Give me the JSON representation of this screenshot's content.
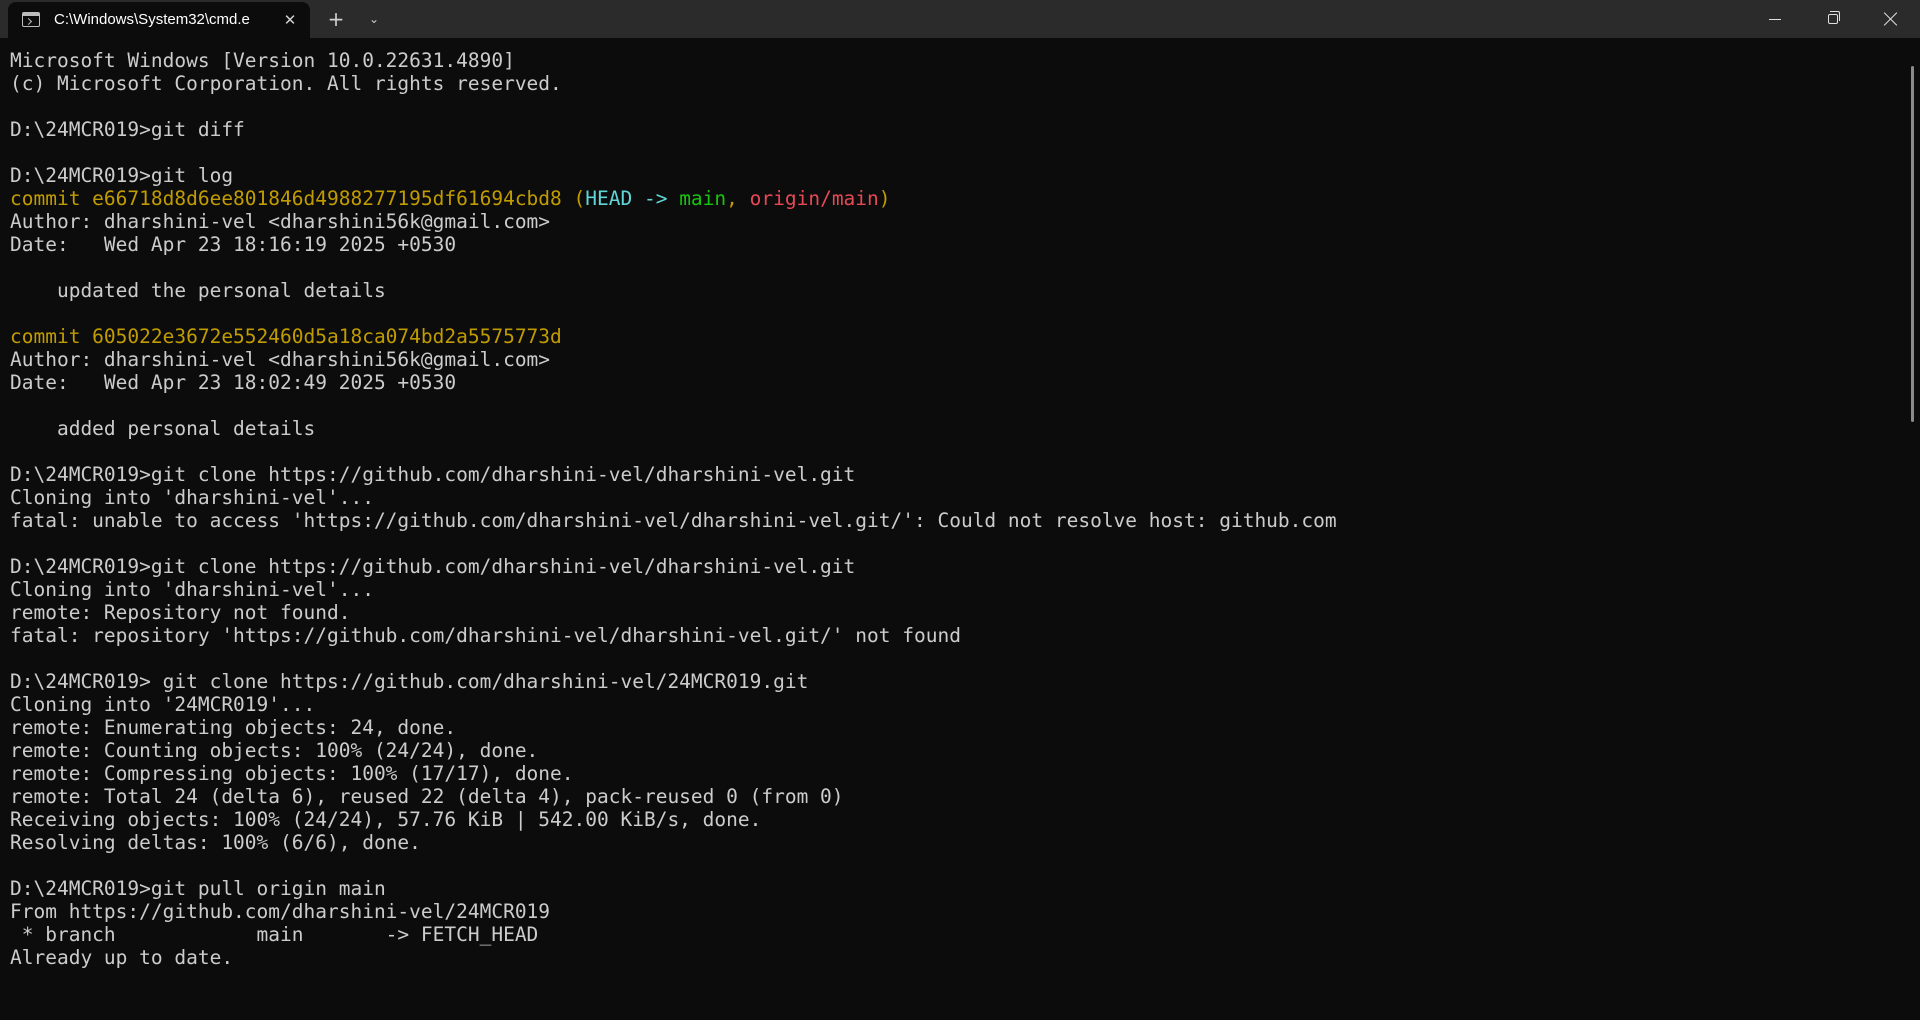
{
  "window": {
    "tab_title": "C:\\Windows\\System32\\cmd.e",
    "new_tab_label": "+",
    "dropdown_label": "⌄",
    "close_tab_label": "✕"
  },
  "terminal": {
    "lines": [
      [
        {
          "t": "Microsoft Windows [Version 10.0.22631.4890]"
        }
      ],
      [
        {
          "t": "(c) Microsoft Corporation. All rights reserved."
        }
      ],
      [],
      [
        {
          "t": "D:\\24MCR019>git diff"
        }
      ],
      [],
      [
        {
          "t": "D:\\24MCR019>git log"
        }
      ],
      [
        {
          "t": "commit e66718d8d6ee801846d4988277195df61694cbd8 (",
          "c": "yellow"
        },
        {
          "t": "HEAD -> ",
          "c": "cyan"
        },
        {
          "t": "main",
          "c": "green"
        },
        {
          "t": ", ",
          "c": "yellow"
        },
        {
          "t": "origin/main",
          "c": "red"
        },
        {
          "t": ")",
          "c": "yellow"
        }
      ],
      [
        {
          "t": "Author: dharshini-vel <dharshini56k@gmail.com>"
        }
      ],
      [
        {
          "t": "Date:   Wed Apr 23 18:16:19 2025 +0530"
        }
      ],
      [],
      [
        {
          "t": "    updated the personal details"
        }
      ],
      [],
      [
        {
          "t": "commit 605022e3672e552460d5a18ca074bd2a5575773d",
          "c": "yellow"
        }
      ],
      [
        {
          "t": "Author: dharshini-vel <dharshini56k@gmail.com>"
        }
      ],
      [
        {
          "t": "Date:   Wed Apr 23 18:02:49 2025 +0530"
        }
      ],
      [],
      [
        {
          "t": "    added personal details"
        }
      ],
      [],
      [
        {
          "t": "D:\\24MCR019>git clone https://github.com/dharshini-vel/dharshini-vel.git"
        }
      ],
      [
        {
          "t": "Cloning into 'dharshini-vel'..."
        }
      ],
      [
        {
          "t": "fatal: unable to access 'https://github.com/dharshini-vel/dharshini-vel.git/': Could not resolve host: github.com"
        }
      ],
      [],
      [
        {
          "t": "D:\\24MCR019>git clone https://github.com/dharshini-vel/dharshini-vel.git"
        }
      ],
      [
        {
          "t": "Cloning into 'dharshini-vel'..."
        }
      ],
      [
        {
          "t": "remote: Repository not found."
        }
      ],
      [
        {
          "t": "fatal: repository 'https://github.com/dharshini-vel/dharshini-vel.git/' not found"
        }
      ],
      [],
      [
        {
          "t": "D:\\24MCR019> git clone https://github.com/dharshini-vel/24MCR019.git"
        }
      ],
      [
        {
          "t": "Cloning into '24MCR019'..."
        }
      ],
      [
        {
          "t": "remote: Enumerating objects: 24, done."
        }
      ],
      [
        {
          "t": "remote: Counting objects: 100% (24/24), done."
        }
      ],
      [
        {
          "t": "remote: Compressing objects: 100% (17/17), done."
        }
      ],
      [
        {
          "t": "remote: Total 24 (delta 6), reused 22 (delta 4), pack-reused 0 (from 0)"
        }
      ],
      [
        {
          "t": "Receiving objects: 100% (24/24), 57.76 KiB | 542.00 KiB/s, done."
        }
      ],
      [
        {
          "t": "Resolving deltas: 100% (6/6), done."
        }
      ],
      [],
      [
        {
          "t": "D:\\24MCR019>git pull origin main"
        }
      ],
      [
        {
          "t": "From https://github.com/dharshini-vel/24MCR019"
        }
      ],
      [
        {
          "t": " * branch            main       -> FETCH_HEAD"
        }
      ],
      [
        {
          "t": "Already up to date."
        }
      ]
    ]
  },
  "colors": {
    "background": "#0c0c0c",
    "foreground": "#cccccc",
    "yellow": "#c19c00",
    "cyan": "#61d6d6",
    "green": "#16c60c",
    "red": "#e74856",
    "titlebar": "#2b2b2b"
  },
  "icons": {
    "tab": "cmd-icon",
    "close_tab": "close-icon",
    "new_tab": "plus-icon",
    "dropdown": "chevron-down-icon",
    "minimize": "minimize-icon",
    "maximize": "restore-icon",
    "close_window": "close-icon"
  }
}
